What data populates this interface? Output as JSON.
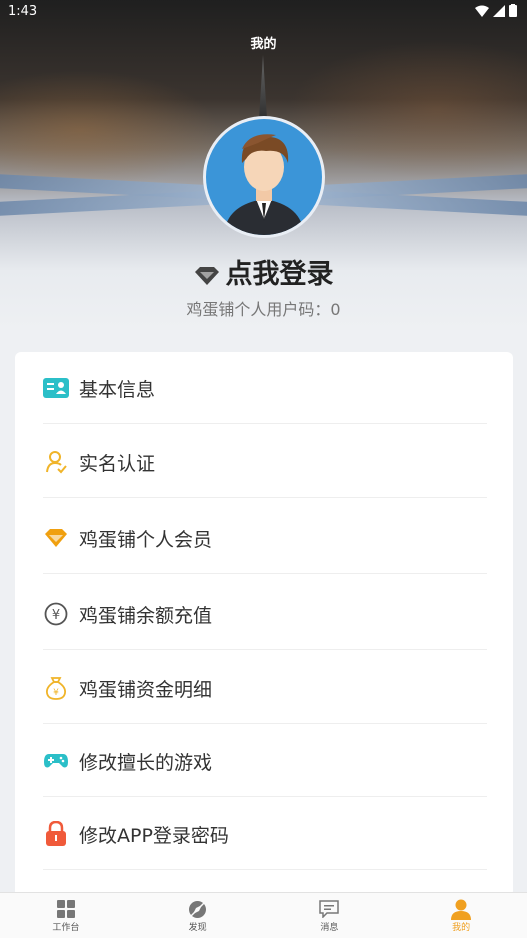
{
  "status_bar": {
    "time": "1:43"
  },
  "header": {
    "title": "我的"
  },
  "profile": {
    "login_text": "点我登录",
    "user_code": "鸡蛋铺个人用户码：0"
  },
  "menu": {
    "items": [
      {
        "label": "基本信息",
        "icon": "id-card-icon",
        "color": "#2bbfc8"
      },
      {
        "label": "实名认证",
        "icon": "user-check-icon",
        "color": "#f0b429"
      },
      {
        "label": "鸡蛋铺个人会员",
        "icon": "diamond-icon",
        "color": "#f0a010"
      },
      {
        "label": "鸡蛋铺余额充值",
        "icon": "yen-circle-icon",
        "color": "#555555"
      },
      {
        "label": "鸡蛋铺资金明细",
        "icon": "money-bag-icon",
        "color": "#f0b429"
      },
      {
        "label": "修改擅长的游戏",
        "icon": "gamepad-icon",
        "color": "#2bbfc8"
      },
      {
        "label": "修改APP登录密码",
        "icon": "lock-icon",
        "color": "#f05a3a"
      }
    ]
  },
  "tabbar": {
    "tabs": [
      {
        "label": "工作台",
        "icon": "grid-icon"
      },
      {
        "label": "发现",
        "icon": "compass-icon"
      },
      {
        "label": "消息",
        "icon": "message-icon"
      },
      {
        "label": "我的",
        "icon": "person-icon",
        "active": true
      }
    ],
    "active_color": "#f0a020"
  }
}
